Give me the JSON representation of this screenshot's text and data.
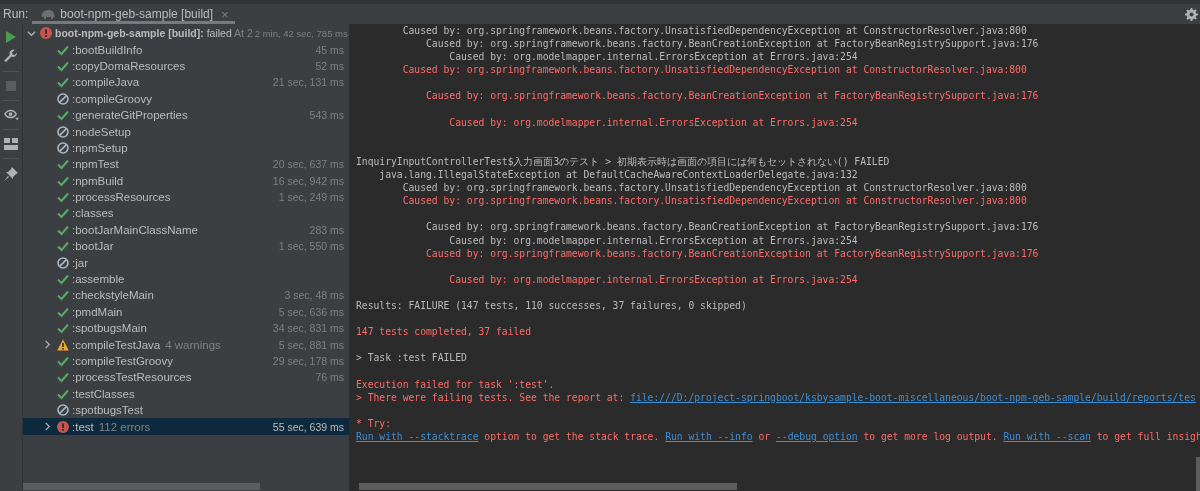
{
  "run_bar": {
    "label": "Run:",
    "tab": {
      "title": "boot-npm-geb-sample [build]",
      "close": "×",
      "selected": true
    }
  },
  "build_tree": {
    "root": {
      "kind": "error",
      "name": "boot-npm-geb-sample [build]:",
      "result": "failed",
      "note": "At 2",
      "time": "2 min, 42 sec, 785 ms",
      "expanded": true,
      "selected": false,
      "children": [
        {
          "kind": "success",
          "name": ":bootBuildInfo",
          "time": "45 ms",
          "selected": false
        },
        {
          "kind": "success",
          "name": ":copyDomaResources",
          "time": "52 ms",
          "selected": false
        },
        {
          "kind": "success",
          "name": ":compileJava",
          "time": "21 sec, 131 ms",
          "selected": false
        },
        {
          "kind": "skipped",
          "name": ":compileGroovy",
          "selected": false
        },
        {
          "kind": "success",
          "name": ":generateGitProperties",
          "time": "543 ms",
          "selected": false
        },
        {
          "kind": "skipped",
          "name": ":nodeSetup",
          "selected": false
        },
        {
          "kind": "skipped",
          "name": ":npmSetup",
          "selected": false
        },
        {
          "kind": "success",
          "name": ":npmTest",
          "time": "20 sec, 637 ms",
          "selected": false
        },
        {
          "kind": "success",
          "name": ":npmBuild",
          "time": "16 sec, 942 ms",
          "selected": false
        },
        {
          "kind": "success",
          "name": ":processResources",
          "time": "1 sec, 249 ms",
          "selected": false
        },
        {
          "kind": "success",
          "name": ":classes",
          "selected": false
        },
        {
          "kind": "success",
          "name": ":bootJarMainClassName",
          "time": "283 ms",
          "selected": false
        },
        {
          "kind": "success",
          "name": ":bootJar",
          "time": "1 sec, 550 ms",
          "selected": false
        },
        {
          "kind": "skipped",
          "name": ":jar",
          "selected": false
        },
        {
          "kind": "success",
          "name": ":assemble",
          "selected": false
        },
        {
          "kind": "success",
          "name": ":checkstyleMain",
          "time": "3 sec, 48 ms",
          "selected": false
        },
        {
          "kind": "success",
          "name": ":pmdMain",
          "time": "5 sec, 636 ms",
          "selected": false
        },
        {
          "kind": "success",
          "name": ":spotbugsMain",
          "time": "34 sec, 831 ms",
          "selected": false
        },
        {
          "kind": "warning",
          "name": ":compileTestJava",
          "note": "4 warnings",
          "time": "5 sec, 881 ms",
          "expanded": false,
          "selected": false
        },
        {
          "kind": "success",
          "name": ":compileTestGroovy",
          "time": "29 sec, 178 ms",
          "selected": false
        },
        {
          "kind": "success",
          "name": ":processTestResources",
          "time": "76 ms",
          "selected": false
        },
        {
          "kind": "success",
          "name": ":testClasses",
          "selected": false
        },
        {
          "kind": "skipped",
          "name": ":spotbugsTest",
          "selected": false
        },
        {
          "kind": "error",
          "name": ":test",
          "note": "112 errors",
          "time": "55 sec, 639 ms",
          "expanded": false,
          "selected": true
        }
      ]
    }
  },
  "console": {
    "lines": [
      {
        "kind": "output",
        "text": "        Caused by: org.springframework.beans.factory.UnsatisfiedDependencyException at ConstructorResolver.java:800"
      },
      {
        "kind": "output",
        "text": "            Caused by: org.springframework.beans.factory.BeanCreationException at FactoryBeanRegistrySupport.java:176"
      },
      {
        "kind": "output",
        "text": "                Caused by: org.modelmapper.internal.ErrorsException at Errors.java:254"
      },
      {
        "kind": "error",
        "text": "        Caused by: org.springframework.beans.factory.UnsatisfiedDependencyException at ConstructorResolver.java:800"
      },
      {
        "kind": "blank"
      },
      {
        "kind": "error",
        "text": "            Caused by: org.springframework.beans.factory.BeanCreationException at FactoryBeanRegistrySupport.java:176"
      },
      {
        "kind": "blank"
      },
      {
        "kind": "error",
        "text": "                Caused by: org.modelmapper.internal.ErrorsException at Errors.java:254"
      },
      {
        "kind": "blank"
      },
      {
        "kind": "blank"
      },
      {
        "kind": "output",
        "text": "InquiryInputControllerTest$入力画面3のテスト > 初期表示時は画面の項目には何もセットされない() FAILED"
      },
      {
        "kind": "output",
        "text": "    java.lang.IllegalStateException at DefaultCacheAwareContextLoaderDelegate.java:132"
      },
      {
        "kind": "output",
        "text": "        Caused by: org.springframework.beans.factory.UnsatisfiedDependencyException at ConstructorResolver.java:800"
      },
      {
        "kind": "error",
        "text": "        Caused by: org.springframework.beans.factory.UnsatisfiedDependencyException at ConstructorResolver.java:800"
      },
      {
        "kind": "blank"
      },
      {
        "kind": "output",
        "text": "            Caused by: org.springframework.beans.factory.BeanCreationException at FactoryBeanRegistrySupport.java:176"
      },
      {
        "kind": "output",
        "text": "                Caused by: org.modelmapper.internal.ErrorsException at Errors.java:254"
      },
      {
        "kind": "error",
        "text": "            Caused by: org.springframework.beans.factory.BeanCreationException at FactoryBeanRegistrySupport.java:176"
      },
      {
        "kind": "blank"
      },
      {
        "kind": "error",
        "text": "                Caused by: org.modelmapper.internal.ErrorsException at Errors.java:254"
      },
      {
        "kind": "blank"
      },
      {
        "kind": "output",
        "text": "Results: FAILURE (147 tests, 110 successes, 37 failures, 0 skipped)"
      },
      {
        "kind": "blank"
      },
      {
        "kind": "error",
        "text": "147 tests completed, 37 failed"
      },
      {
        "kind": "blank"
      },
      {
        "kind": "output",
        "text": "> Task :test FAILED"
      },
      {
        "kind": "blank"
      },
      {
        "kind": "error",
        "text": "Execution failed for task ':test'."
      },
      {
        "kind": "mixed",
        "parts": [
          {
            "text": "> There were failing tests. See the report at: ",
            "link": false
          },
          {
            "text": "file:///D:/project-springboot/ksbysample-boot-miscellaneous/boot-npm-geb-sample/build/reports/tes",
            "link": true
          }
        ]
      },
      {
        "kind": "blank"
      },
      {
        "kind": "error",
        "text": "* Try:"
      },
      {
        "kind": "mixed",
        "parts": [
          {
            "text": "Run with --stacktrace",
            "link": true
          },
          {
            "text": " option to get the stack trace. ",
            "link": false
          },
          {
            "text": "Run with --info",
            "link": true
          },
          {
            "text": " or ",
            "link": false
          },
          {
            "text": "--debug option",
            "link": true
          },
          {
            "text": " to get more log output. ",
            "link": false
          },
          {
            "text": "Run with --scan",
            "link": true
          },
          {
            "text": " to get full insigh",
            "link": false
          }
        ]
      }
    ]
  }
}
